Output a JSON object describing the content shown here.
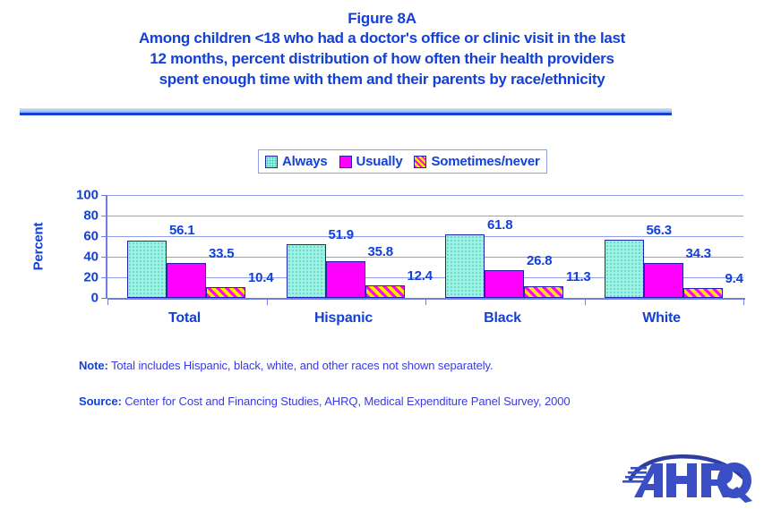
{
  "figure": {
    "number": "Figure 8A",
    "title_lines": [
      "Among children &lt;18 who had a doctor's office or clinic visit in the last",
      "12 months, percent distribution of how often their health providers",
      "spent enough time with them and their parents by race/ethnicity"
    ],
    "title_line_1": "Among children <18 who had a doctor's office or clinic visit in the last",
    "title_line_2": "12 months, percent distribution of how often their health providers",
    "title_line_3": "spent enough time with them and their parents by race/ethnicity"
  },
  "legend": {
    "items": [
      {
        "label": "Always",
        "swatch": "always-swatch-icon",
        "color": "#9ff2e3"
      },
      {
        "label": "Usually",
        "swatch": "usually-swatch-icon",
        "color": "#FF00FF"
      },
      {
        "label": "Sometimes/never",
        "swatch": "sometimes-never-swatch-icon",
        "color": "#FFE800"
      }
    ]
  },
  "axes": {
    "y_title": "Percent",
    "y_ticks": [
      "100",
      "80",
      "60",
      "40",
      "20",
      "0"
    ]
  },
  "notes": {
    "note_label": "Note:",
    "note_text": "Total includes Hispanic, black, white, and other races not shown separately.",
    "source_label": "Source:",
    "source_text": "Center for Cost and Financing Studies, AHRQ, Medical Expenditure Panel Survey, 2000"
  },
  "logo": {
    "name": "ahrq-logo",
    "text": "AHRQ"
  },
  "colors": {
    "title_blue": "#1340D6",
    "text_blue": "#3A3AE0",
    "always": "#9ff2e3",
    "usually": "#FF00FF",
    "sometimes_never": "#FFE800",
    "gridline": "#8f9fe8"
  },
  "chart_data": {
    "type": "bar",
    "title": "Among children <18 who had a doctor's office or clinic visit in the last 12 months, percent distribution of how often their health providers spent enough time with them and their parents by race/ethnicity",
    "subtitle": "Figure 8A",
    "xlabel": "",
    "ylabel": "Percent",
    "ylim": [
      0,
      100
    ],
    "yticks": [
      0,
      20,
      40,
      60,
      80,
      100
    ],
    "grid": true,
    "legend_position": "top-center",
    "categories": [
      "Total",
      "Hispanic",
      "Black",
      "White"
    ],
    "series": [
      {
        "name": "Always",
        "values": [
          56.1,
          51.9,
          61.8,
          56.3
        ]
      },
      {
        "name": "Usually",
        "values": [
          33.5,
          35.8,
          26.8,
          34.3
        ]
      },
      {
        "name": "Sometimes/never",
        "values": [
          10.4,
          12.4,
          11.3,
          9.4
        ]
      }
    ],
    "data_labels": [
      [
        "56.1",
        "33.5",
        "10.4"
      ],
      [
        "51.9",
        "35.8",
        "12.4"
      ],
      [
        "61.8",
        "26.8",
        "11.3"
      ],
      [
        "56.3",
        "34.3",
        "9.4"
      ]
    ]
  }
}
